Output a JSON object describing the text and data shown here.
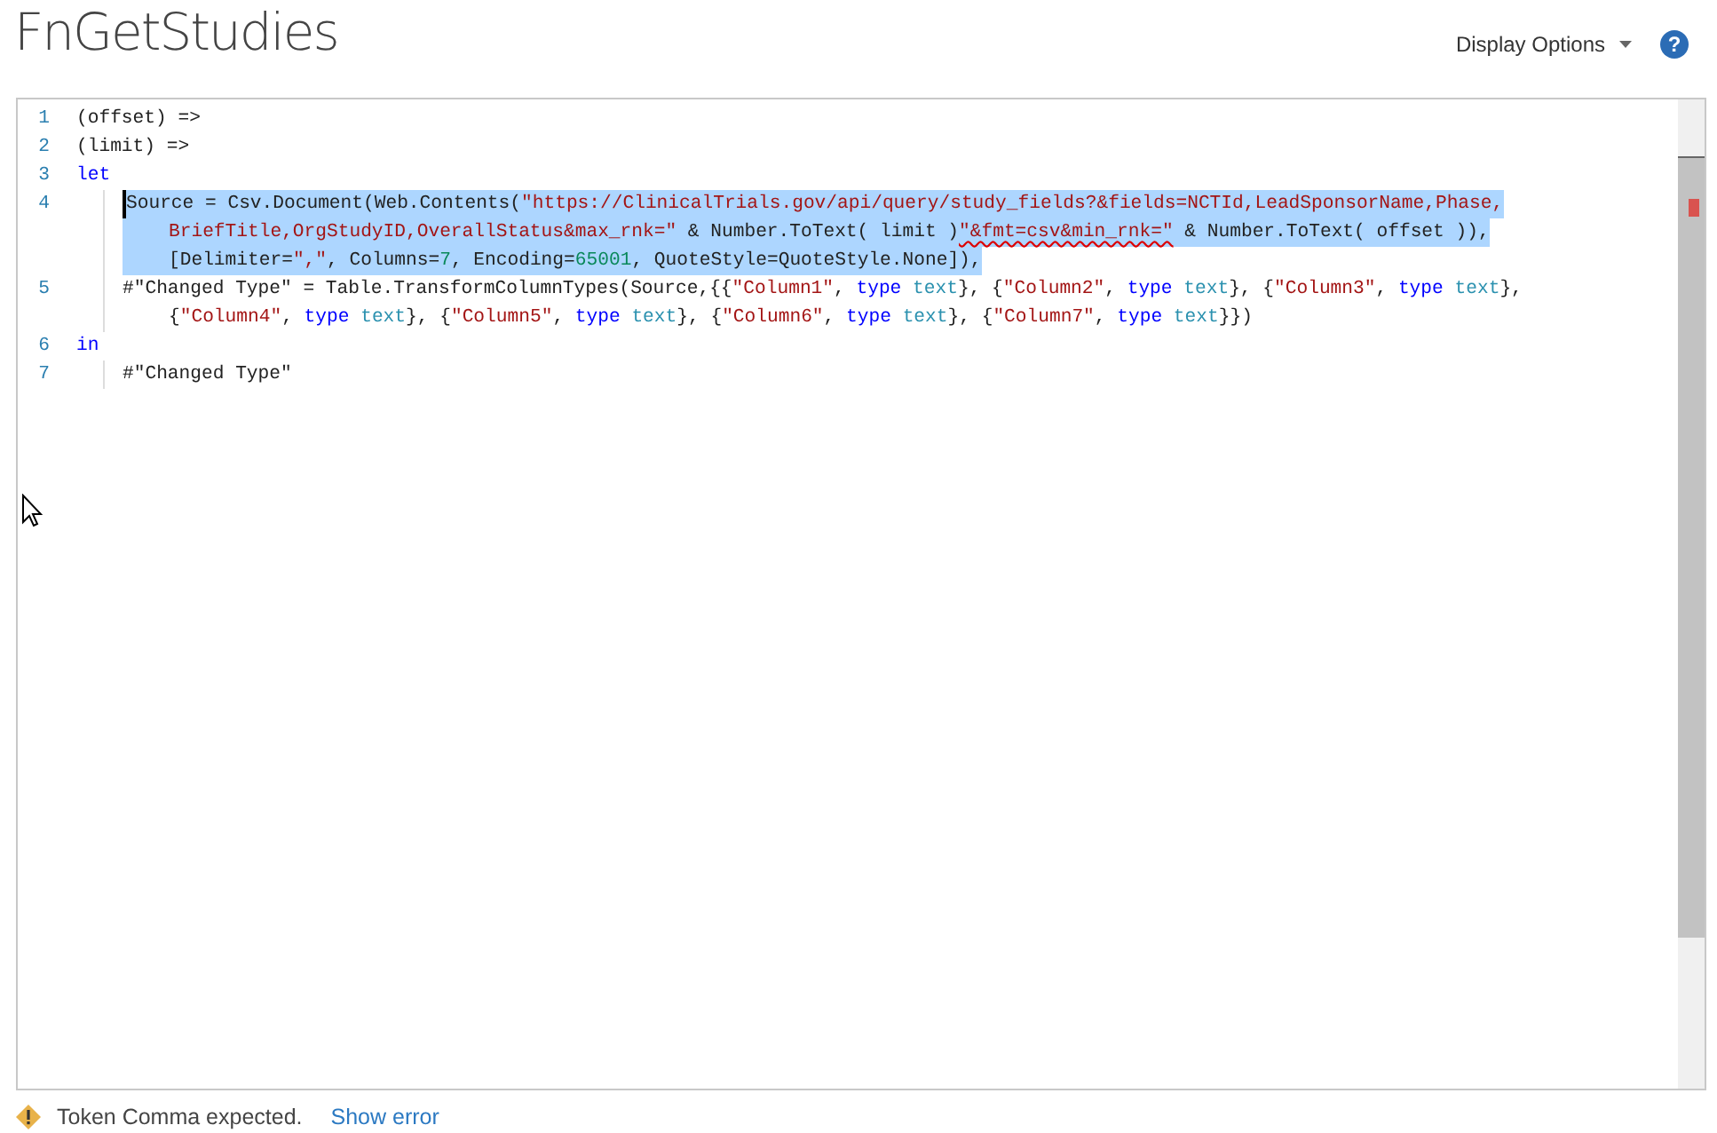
{
  "title": "FnGetStudies",
  "display_options": {
    "label": "Display Options"
  },
  "help": {
    "label": "?"
  },
  "editor": {
    "lines": [
      {
        "number": "1",
        "selected": false,
        "rows": [
          {
            "tokens": [
              {
                "text": "(offset) =>",
                "kind": "plain"
              }
            ]
          }
        ]
      },
      {
        "number": "2",
        "selected": false,
        "rows": [
          {
            "tokens": [
              {
                "text": "(limit) =>",
                "kind": "plain"
              }
            ]
          }
        ]
      },
      {
        "number": "3",
        "selected": false,
        "rows": [
          {
            "tokens": [
              {
                "text": "let",
                "kind": "keyword"
              }
            ]
          }
        ],
        "children": [
          {
            "number": "4",
            "selected": true,
            "cursor": true,
            "rows": [
              {
                "tokens": [
                  {
                    "text": "Source = Csv.Document(Web.Contents(",
                    "kind": "plain"
                  },
                  {
                    "text": "\"https://ClinicalTrials.gov/api/query/study_fields?&fields=NCTId,LeadSponsorName,Phase,",
                    "kind": "string"
                  }
                ]
              },
              {
                "tokens": [
                  {
                    "text": "BriefTitle,OrgStudyID,OverallStatus&max_rnk=\"",
                    "kind": "string"
                  },
                  {
                    "text": " & Number.ToText( limit )",
                    "kind": "plain"
                  },
                  {
                    "text": "\"&fmt=csv&min_rnk=\"",
                    "kind": "string",
                    "error": true
                  },
                  {
                    "text": " & Number.ToText( offset )),",
                    "kind": "plain"
                  }
                ]
              },
              {
                "tokens": [
                  {
                    "text": "[Delimiter=",
                    "kind": "plain"
                  },
                  {
                    "text": "\",\"",
                    "kind": "string"
                  },
                  {
                    "text": ", Columns=",
                    "kind": "plain"
                  },
                  {
                    "text": "7",
                    "kind": "number"
                  },
                  {
                    "text": ", Encoding=",
                    "kind": "plain"
                  },
                  {
                    "text": "65001",
                    "kind": "number"
                  },
                  {
                    "text": ", QuoteStyle=QuoteStyle.None]),",
                    "kind": "plain"
                  }
                ]
              }
            ]
          },
          {
            "number": "5",
            "selected": false,
            "rows": [
              {
                "tokens": [
                  {
                    "text": "#\"Changed Type\" = Table.TransformColumnTypes(Source,{{",
                    "kind": "plain"
                  },
                  {
                    "text": "\"Column1\"",
                    "kind": "string"
                  },
                  {
                    "text": ", ",
                    "kind": "plain"
                  },
                  {
                    "keyword": "type",
                    "type_name": "text",
                    "kind": "typed"
                  },
                  {
                    "text": "}, {",
                    "kind": "plain"
                  },
                  {
                    "text": "\"Column2\"",
                    "kind": "string"
                  },
                  {
                    "text": ", ",
                    "kind": "plain"
                  },
                  {
                    "keyword": "type",
                    "type_name": "text",
                    "kind": "typed"
                  },
                  {
                    "text": "}, {",
                    "kind": "plain"
                  },
                  {
                    "text": "\"Column3\"",
                    "kind": "string"
                  },
                  {
                    "text": ", ",
                    "kind": "plain"
                  },
                  {
                    "keyword": "type",
                    "type_name": "text",
                    "kind": "typed"
                  },
                  {
                    "text": "},",
                    "kind": "plain"
                  }
                ]
              },
              {
                "tokens": [
                  {
                    "text": "{",
                    "kind": "plain"
                  },
                  {
                    "text": "\"Column4\"",
                    "kind": "string"
                  },
                  {
                    "text": ", ",
                    "kind": "plain"
                  },
                  {
                    "keyword": "type",
                    "type_name": "text",
                    "kind": "typed"
                  },
                  {
                    "text": "}, {",
                    "kind": "plain"
                  },
                  {
                    "text": "\"Column5\"",
                    "kind": "string"
                  },
                  {
                    "text": ", ",
                    "kind": "plain"
                  },
                  {
                    "keyword": "type",
                    "type_name": "text",
                    "kind": "typed"
                  },
                  {
                    "text": "}, {",
                    "kind": "plain"
                  },
                  {
                    "text": "\"Column6\"",
                    "kind": "string"
                  },
                  {
                    "text": ", ",
                    "kind": "plain"
                  },
                  {
                    "keyword": "type",
                    "type_name": "text",
                    "kind": "typed"
                  },
                  {
                    "text": "}, {",
                    "kind": "plain"
                  },
                  {
                    "text": "\"Column7\"",
                    "kind": "string"
                  },
                  {
                    "text": ", ",
                    "kind": "plain"
                  },
                  {
                    "keyword": "type",
                    "type_name": "text",
                    "kind": "typed"
                  },
                  {
                    "text": "}})",
                    "kind": "plain"
                  }
                ]
              }
            ]
          }
        ]
      },
      {
        "number": "6",
        "selected": false,
        "rows": [
          {
            "tokens": [
              {
                "text": "in",
                "kind": "keyword"
              }
            ]
          }
        ],
        "children": [
          {
            "number": "7",
            "selected": false,
            "rows": [
              {
                "tokens": [
                  {
                    "text": "#\"Changed Type\"",
                    "kind": "plain"
                  }
                ]
              }
            ]
          }
        ]
      }
    ]
  },
  "status": {
    "message": "Token Comma expected.",
    "link": "Show error"
  }
}
